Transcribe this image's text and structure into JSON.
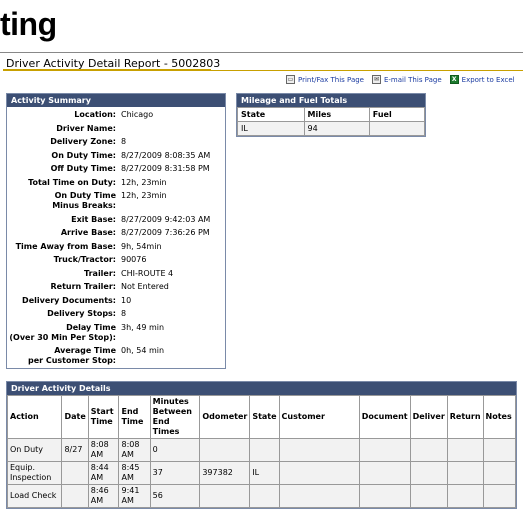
{
  "page": {
    "heading_fragment": "ting"
  },
  "report": {
    "title": "Driver Activity Detail Report - 5002803"
  },
  "links": [
    {
      "label": "Print/Fax This Page",
      "icon": "printer-icon"
    },
    {
      "label": "E-mail This Page",
      "icon": "email-icon"
    },
    {
      "label": "Export to Excel",
      "icon": "excel-icon"
    }
  ],
  "summary": {
    "header": "Activity Summary",
    "rows": [
      {
        "k": "Location:",
        "v": "Chicago"
      },
      {
        "k": "Driver Name:",
        "v": ""
      },
      {
        "k": "Delivery Zone:",
        "v": "8"
      },
      {
        "k": "On Duty Time:",
        "v": "8/27/2009 8:08:35 AM"
      },
      {
        "k": "Off Duty Time:",
        "v": "8/27/2009 8:31:58 PM"
      },
      {
        "k": "Total Time on Duty:",
        "v": "12h, 23min"
      },
      {
        "k1": "On Duty Time",
        "k2": "Minus Breaks:",
        "v": "12h, 23min"
      },
      {
        "k": "Exit Base:",
        "v": "8/27/2009 9:42:03 AM"
      },
      {
        "k": "Arrive Base:",
        "v": "8/27/2009 7:36:26 PM"
      },
      {
        "k": "Time Away from Base:",
        "v": "9h, 54min"
      },
      {
        "k": "Truck/Tractor:",
        "v": "90076"
      },
      {
        "k": "Trailer:",
        "v": "CHI-ROUTE 4"
      },
      {
        "k": "Return Trailer:",
        "v": "Not Entered"
      },
      {
        "k": "Delivery Documents:",
        "v": "10"
      },
      {
        "k": "Delivery Stops:",
        "v": "8"
      },
      {
        "k1": "Delay Time",
        "k2": "(Over 30 Min Per Stop):",
        "v": "3h, 49 min"
      },
      {
        "k1": "Average Time",
        "k2": "per Customer Stop:",
        "v": "0h, 54 min"
      }
    ]
  },
  "mileage": {
    "header": "Mileage and Fuel Totals",
    "columns": [
      "State",
      "Miles",
      "Fuel"
    ],
    "rows": [
      [
        "IL",
        "94",
        ""
      ]
    ]
  },
  "details": {
    "header": "Driver Activity Details",
    "columns": [
      "Action",
      "Date",
      "Start Time",
      "End Time",
      "Minutes Between End Times",
      "Odometer",
      "State",
      "Customer",
      "Document",
      "Deliver",
      "Return",
      "Notes"
    ],
    "rows": [
      [
        "On Duty",
        "8/27",
        "8:08 AM",
        "8:08 AM",
        "0",
        "",
        "",
        "",
        "",
        "",
        "",
        ""
      ],
      [
        "Equip. Inspection",
        "",
        "8:44 AM",
        "8:45 AM",
        "37",
        "397382",
        "IL",
        "",
        "",
        "",
        "",
        ""
      ],
      [
        "Load Check",
        "",
        "8:46 AM",
        "9:41 AM",
        "56",
        "",
        "",
        "",
        "",
        "",
        "",
        ""
      ]
    ]
  }
}
